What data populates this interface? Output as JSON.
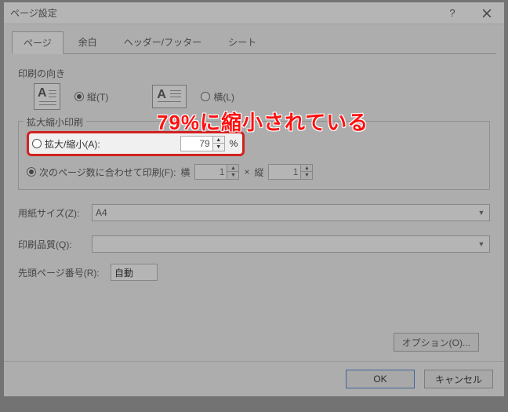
{
  "title": "ページ設定",
  "tabs": {
    "page": "ページ",
    "margins": "余白",
    "headerfooter": "ヘッダー/フッター",
    "sheet": "シート"
  },
  "orientation": {
    "label": "印刷の向き",
    "portrait": "縦(T)",
    "landscape": "横(L)"
  },
  "scaling": {
    "legend": "拡大縮小印刷",
    "adjust_label": "拡大/縮小(A):",
    "adjust_value": "79",
    "percent": "%",
    "fit_label": "次のページ数に合わせて印刷(F):",
    "fit_wide_label": "横",
    "fit_wide_value": "1",
    "fit_times": "×",
    "fit_tall_label": "縦",
    "fit_tall_value": "1"
  },
  "paper": {
    "label": "用紙サイズ(Z):",
    "value": "A4"
  },
  "quality": {
    "label": "印刷品質(Q):",
    "value": ""
  },
  "firstpage": {
    "label": "先頭ページ番号(R):",
    "value": "自動"
  },
  "options_btn": "オプション(O)...",
  "ok": "OK",
  "cancel": "キャンセル",
  "annotation": "79%に縮小されている"
}
